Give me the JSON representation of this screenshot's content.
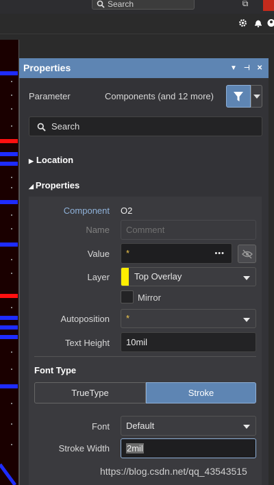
{
  "topbar": {
    "search_placeholder": "Search",
    "restore_glyph": "⧉"
  },
  "toolbar": {
    "icons": [
      "gear-icon",
      "bell-icon",
      "user-icon"
    ]
  },
  "panel": {
    "title": "Properties",
    "header_controls": [
      "▼",
      "⊣",
      "✕"
    ],
    "parameter_label": "Parameter",
    "filter_text": "Components (and 12 more)",
    "search_placeholder": "Search",
    "sections": {
      "location": "Location",
      "properties": "Properties"
    },
    "rows": {
      "component_label": "Component",
      "component_value": "O2",
      "name_label": "Name",
      "name_placeholder": "Comment",
      "value_label": "Value",
      "value_value": "*",
      "value_more": "•••",
      "layer_label": "Layer",
      "layer_value": "Top Overlay",
      "mirror_label": "Mirror",
      "autoposition_label": "Autoposition",
      "autoposition_value": "*",
      "text_height_label": "Text Height",
      "text_height_value": "10mil"
    },
    "font_type": {
      "heading": "Font Type",
      "options": [
        "TrueType",
        "Stroke"
      ],
      "selected": "Stroke"
    },
    "font_label": "Font",
    "font_value": "Default",
    "stroke_width_label": "Stroke Width",
    "stroke_width_value": "2mil"
  },
  "watermark": "https://blog.csdn.net/qq_43543515",
  "colors": {
    "accent": "#5e85b3",
    "layer_swatch": "#ffee00",
    "pcb_blue": "#1e2cff",
    "pcb_red": "#ff1010"
  }
}
